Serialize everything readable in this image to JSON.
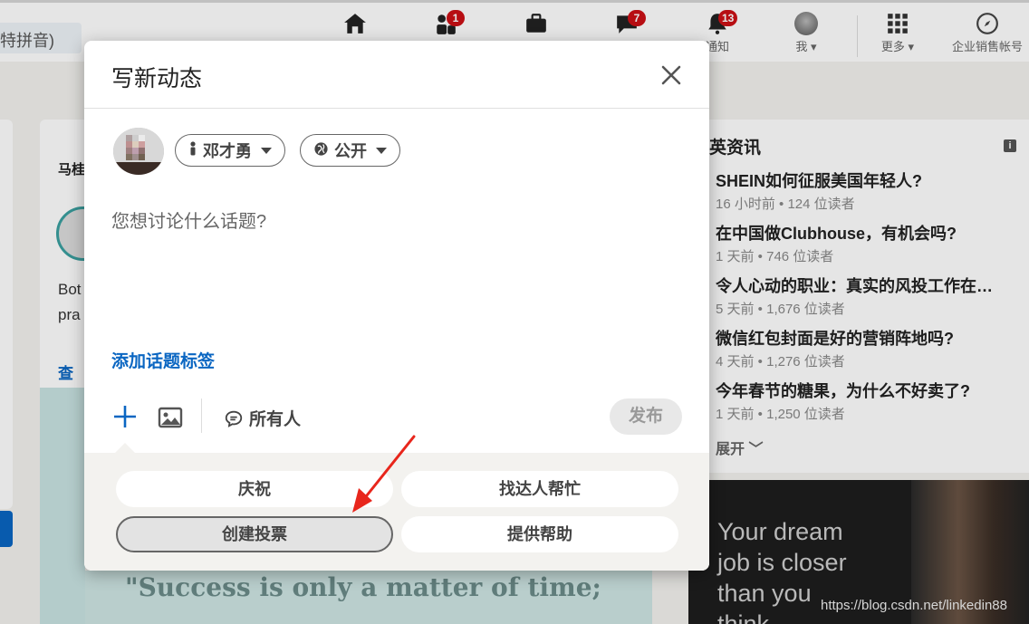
{
  "topbar": {
    "search_partial": "特拼音)",
    "nav": [
      {
        "icon": "home-icon",
        "label": "",
        "badge": ""
      },
      {
        "icon": "network-icon",
        "label": "",
        "badge": "1"
      },
      {
        "icon": "jobs-icon",
        "label": "",
        "badge": ""
      },
      {
        "icon": "messaging-icon",
        "label": "",
        "badge": "7"
      },
      {
        "icon": "notifications-icon",
        "label": "通知",
        "badge": "13"
      },
      {
        "icon": "me-avatar",
        "label": "我",
        "badge": ""
      },
      {
        "icon": "grid-icon",
        "label": "更多",
        "badge": ""
      },
      {
        "icon": "compass-icon",
        "label": "企业销售帐号",
        "badge": ""
      }
    ]
  },
  "left_card": {
    "name_partial": "马桂",
    "text_line1": "Bot",
    "text_line2": "pra",
    "see_more": "查看"
  },
  "news": {
    "title": "英资讯",
    "items": [
      {
        "headline": "SHEIN如何征服美国年轻人?",
        "meta": "16 小时前 • 124 位读者"
      },
      {
        "headline": "在中国做Clubhouse，有机会吗?",
        "meta": "1 天前 • 746 位读者"
      },
      {
        "headline": "令人心动的职业：真实的风投工作在…",
        "meta": "5 天前 • 1,676 位读者"
      },
      {
        "headline": "微信红包封面是好的营销阵地吗?",
        "meta": "4 天前 • 1,276 位读者"
      },
      {
        "headline": "今年春节的糖果，为什么不好卖了?",
        "meta": "1 天前 • 1,250 位读者"
      }
    ],
    "expand_label": "展开"
  },
  "ad": {
    "line1": "Your dream",
    "line2": "job is closer",
    "line3": "than you",
    "line4": "think"
  },
  "quote_banner": "\"Success is only a matter of time;",
  "watermark": "https://blog.csdn.net/linkedin88",
  "modal": {
    "title": "写新动态",
    "author_name": "邓才勇",
    "visibility": "公开",
    "composer_placeholder": "您想讨论什么话题?",
    "hashtag_link": "添加话题标签",
    "audience": "所有人",
    "post_label": "发布",
    "tray": {
      "celebrate": "庆祝",
      "find_expert": "找达人帮忙",
      "create_poll": "创建投票",
      "offer_help": "提供帮助"
    }
  },
  "colors": {
    "accent": "#0a66c2",
    "badge": "#cc1016",
    "annotation_arrow": "#e8261c"
  }
}
